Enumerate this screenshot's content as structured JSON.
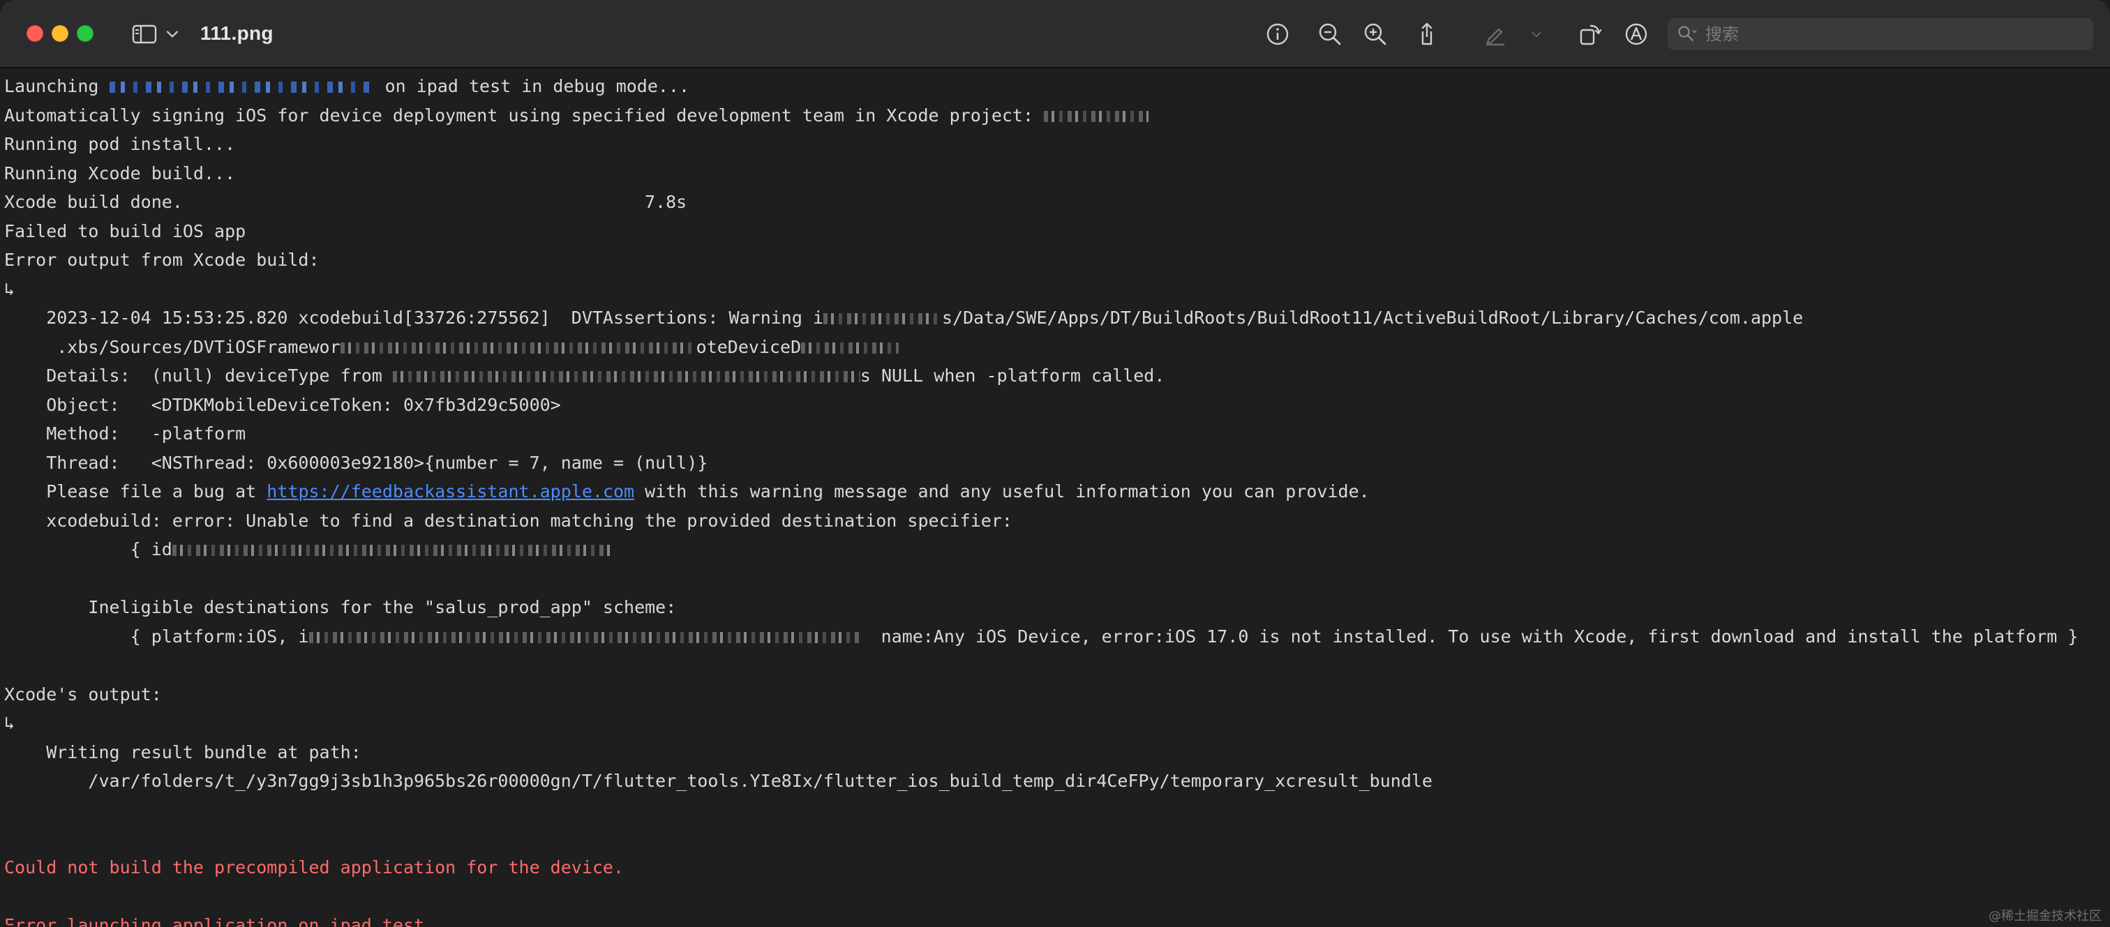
{
  "window": {
    "title": "111.png"
  },
  "toolbar": {
    "search_placeholder": "搜索",
    "icons": [
      "sidebar-icon",
      "chevron-down-icon",
      "info-icon",
      "zoom-out-icon",
      "zoom-in-icon",
      "share-icon",
      "markup-pen-icon",
      "rotate-icon",
      "annotate-icon",
      "search-icon"
    ]
  },
  "colors": {
    "background": "#1e1e1e",
    "text": "#d9d9d9",
    "error": "#ff6b6b",
    "link": "#4a8cff"
  },
  "terminal": {
    "l01_a": "Launching ",
    "l01_b": " on ipad test in debug mode...",
    "l02_a": "Automatically signing iOS for device deployment using specified development team in Xcode project: ",
    "l03": "Running pod install...",
    "l04": "Running Xcode build...",
    "l05_a": "Xcode build done.",
    "l05_b": "7.8s",
    "l06": "Failed to build iOS app",
    "l07": "Error output from Xcode build:",
    "l08": "↳",
    "l09_a": "    2023-12-04 15:53:25.820 xcodebuild[33726:275562]  DVTAssertions: Warning i",
    "l09_b": "s/Data/SWE/Apps/DT/BuildRoots/BuildRoot11/ActiveBuildRoot/Library/Caches/com.apple",
    "l10_a": "     .xbs/Sources/DVTiOSFramewor",
    "l10_b": "oteDeviceD",
    "l11_a": "    Details:  (null) deviceType from ",
    "l11_b": "s NULL when -platform called.",
    "l12": "    Object:   <DTDKMobileDeviceToken: 0x7fb3d29c5000>",
    "l13": "    Method:   -platform",
    "l14": "    Thread:   <NSThread: 0x600003e92180>{number = 7, name = (null)}",
    "l15_a": "    Please file a bug at ",
    "l15_link": "https://feedbackassistant.apple.com",
    "l15_b": " with this warning message and any useful information you can provide.",
    "l16": "    xcodebuild: error: Unable to find a destination matching the provided destination specifier:",
    "l17_a": "            { id",
    "l18": "        Ineligible destinations for the \"salus_prod_app\" scheme:",
    "l19_a": "            { platform:iOS, i",
    "l19_b": "  name:Any iOS Device, error:iOS 17.0 is not installed. To use with Xcode, first download and install the platform }",
    "l20": "Xcode's output:",
    "l21": "↳",
    "l22": "    Writing result bundle at path:",
    "l23": "        /var/folders/t_/y3n7gg9j3sb1h3p965bs26r00000gn/T/flutter_tools.YIe8Ix/flutter_ios_build_temp_dir4CeFPy/temporary_xcresult_bundle",
    "l24": "Could not build the precompiled application for the device.",
    "l25": "Error launching application on ipad test."
  },
  "watermark": "@稀土掘金技术社区"
}
